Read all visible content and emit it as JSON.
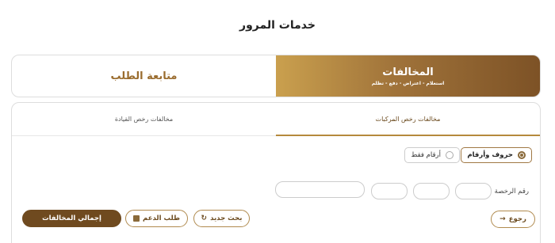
{
  "page": {
    "title": "خدمات المرور"
  },
  "top_tabs": [
    {
      "label": "المخالفات",
      "subtitle": "استعلام - اعتراض - دفع - تظلم",
      "active": true
    },
    {
      "label": "متابعة الطلب",
      "active": false
    }
  ],
  "sub_tabs": [
    {
      "label": "مخالفات رخص المركبات",
      "active": true
    },
    {
      "label": "مخالفات رخص القيادة",
      "active": false
    }
  ],
  "plate_type": {
    "options": [
      {
        "label": "حروف وأرقام",
        "selected": true
      },
      {
        "label": "أرقام فقط",
        "selected": false
      }
    ]
  },
  "plate": {
    "label": "رقم الرخصة"
  },
  "buttons": {
    "back": "رجوع",
    "new_search": "بحث جديد",
    "support": "طلب الدعم",
    "total": "إجمالي المخالفات"
  },
  "colors": {
    "accent_dark": "#6f4a1f",
    "accent_gold": "#caa04e",
    "accent_mid": "#a0733a"
  },
  "icons": {
    "back": "arrow-right-icon",
    "new_search": "refresh-icon",
    "support": "support-square-icon"
  }
}
